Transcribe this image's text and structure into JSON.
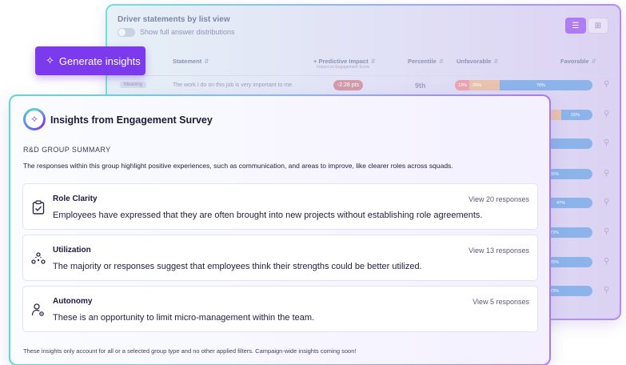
{
  "background_table": {
    "title": "Driver statements by list view",
    "toggle_label": "Show full answer distributions",
    "view_list_icon": "list-icon",
    "view_grid_icon": "grid-icon",
    "headers": {
      "statement": "Statement",
      "predictive_impact": "+ Predictive Impact",
      "predictive_impact_sub": "Impact on Engagement Score",
      "percentile": "Percentile",
      "unfavorable": "Unfavorable",
      "favorable": "Favorable"
    },
    "first_row": {
      "category": "Meaning",
      "statement": "The work I do on this job is very important to me.",
      "impact": "-2.28 pts",
      "percentile": "9th",
      "unfavorable_pct": "13%",
      "neutral_pct": "25%",
      "favorable_pct": "70%"
    },
    "partial_favorable_labels": [
      "15%",
      "65%",
      "47%",
      "73%",
      "75%",
      "73%"
    ]
  },
  "generate_button": {
    "label": "Generate insights",
    "icon": "sparkle-icon"
  },
  "insights_card": {
    "title": "Insights from Engagement Survey",
    "summary_label": "R&D GROUP SUMMARY",
    "summary_text": "The responses within this group highlight positive experiences, such as communication, and areas to improve, like clearer roles across squads.",
    "items": [
      {
        "title": "Role Clarity",
        "body": "Employees have expressed that they are often brought into new projects without establishing role agreements.",
        "link": "View 20 responses",
        "icon": "clipboard-check-icon"
      },
      {
        "title": "Utilization",
        "body": "The majority or responses suggest that employees think their strengths could be better utilized.",
        "link": "View 13 responses",
        "icon": "team-network-icon"
      },
      {
        "title": "Autonomy",
        "body": "These is an opportunity to limit micro-management within the team.",
        "link": "View 5 responses",
        "icon": "user-gear-icon"
      }
    ],
    "footnote": "These insights only account for all or a selected group type and no other applied filters. Campaign-wide insights coming soon!"
  }
}
